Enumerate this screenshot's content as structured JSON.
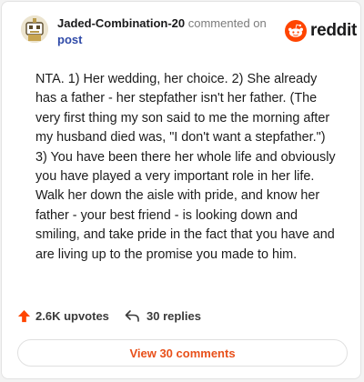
{
  "header": {
    "author": "Jaded-Combination-20",
    "action": "commented on",
    "post_link": "post",
    "avatar_icon": "robot-avatar-icon",
    "brand": {
      "icon": "reddit-snoo-icon",
      "wordmark": "reddit",
      "color": "#ff4500"
    }
  },
  "comment": {
    "text": "NTA. 1) Her wedding, her choice. 2) She already has a father - her stepfather isn't her father. (The very first thing my son said to me the morning after my husband died was, \"I don't want a stepfather.\") 3) You have been there her whole life and obviously you have played a very important role in her life. Walk her down the aisle with pride, and know her father - your best friend - is looking down and smiling, and take pride in the fact that you have and are living up to the promise you made to him."
  },
  "footer": {
    "upvotes": "2.6K upvotes",
    "upvote_icon": "upvote-arrow-icon",
    "upvote_color": "#ff4500",
    "replies": "30 replies",
    "reply_icon": "reply-arrow-icon",
    "view_button": "View 30 comments",
    "link_color": "#e8501a"
  }
}
